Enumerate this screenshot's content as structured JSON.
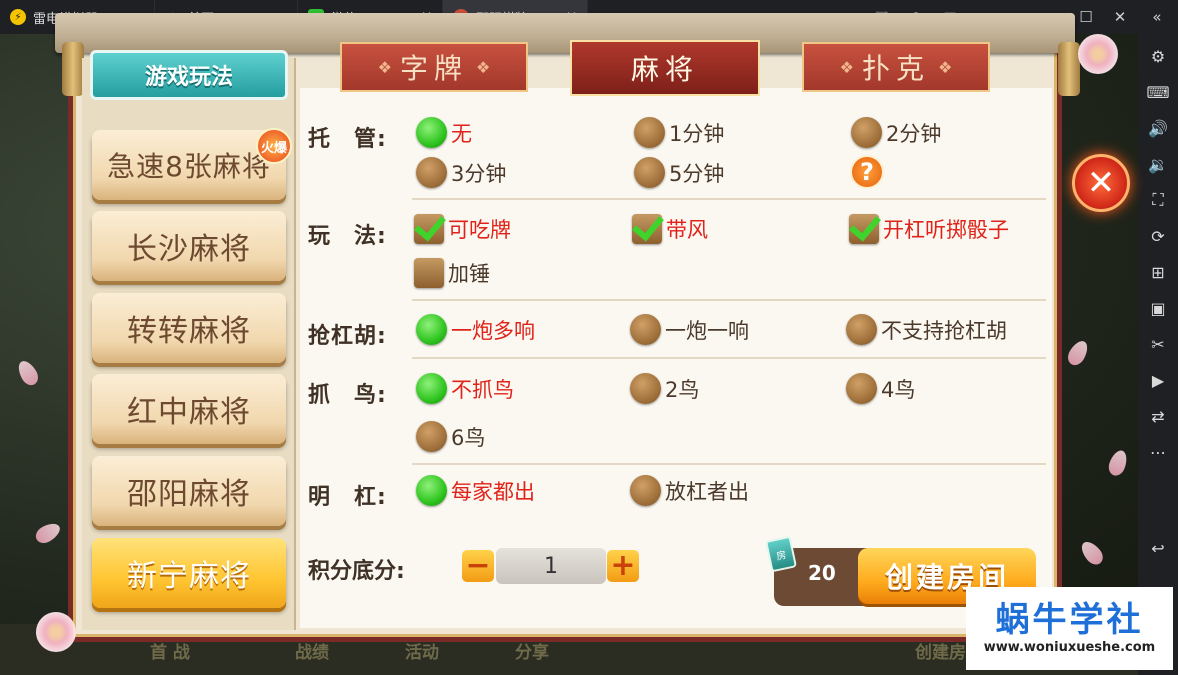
{
  "emulator": {
    "app_name": "雷电模拟器",
    "tabs": [
      {
        "label": "首页"
      },
      {
        "label": "微信"
      },
      {
        "label": "邵阳棋牌"
      }
    ],
    "close_glyph": "×",
    "window_buttons": [
      "gamepad-icon",
      "user-icon",
      "mail-icon",
      "menu-icon",
      "external-icon",
      "minimize-icon",
      "maximize-icon",
      "close-icon",
      "collapse-icon"
    ],
    "sidebar_icons": [
      "settings-icon",
      "keyboard-icon",
      "volume-up-icon",
      "volume-down-icon",
      "fullscreen-icon",
      "rotate-icon",
      "add-screen-icon",
      "apk-icon",
      "scissors-icon",
      "video-icon",
      "sync-icon",
      "more-icon",
      "back-icon"
    ]
  },
  "dialog": {
    "mode_header": "游戏玩法",
    "hot_badge": "火爆",
    "modes": [
      {
        "label": "急速8张麻将",
        "active": false
      },
      {
        "label": "长沙麻将",
        "active": false
      },
      {
        "label": "转转麻将",
        "active": false
      },
      {
        "label": "红中麻将",
        "active": false
      },
      {
        "label": "邵阳麻将",
        "active": false
      },
      {
        "label": "新宁麻将",
        "active": true
      }
    ],
    "categories": [
      {
        "label": "字牌",
        "active": false
      },
      {
        "label": "麻将",
        "active": true
      },
      {
        "label": "扑克",
        "active": false
      }
    ],
    "rules": {
      "trustee": {
        "label": "托　管:",
        "options": [
          {
            "label": "无",
            "selected": true
          },
          {
            "label": "1分钟",
            "selected": false
          },
          {
            "label": "2分钟",
            "selected": false
          },
          {
            "label": "3分钟",
            "selected": false
          },
          {
            "label": "5分钟",
            "selected": false
          }
        ],
        "help": "?"
      },
      "play": {
        "label": "玩　法:",
        "options": [
          {
            "label": "可吃牌",
            "checked": true
          },
          {
            "label": "带风",
            "checked": true
          },
          {
            "label": "开杠听掷骰子",
            "checked": true
          },
          {
            "label": "加锤",
            "checked": false
          }
        ]
      },
      "rob_kong": {
        "label": "抢杠胡:",
        "options": [
          {
            "label": "一炮多响",
            "selected": true
          },
          {
            "label": "一炮一响",
            "selected": false
          },
          {
            "label": "不支持抢杠胡",
            "selected": false
          }
        ]
      },
      "birds": {
        "label": "抓　鸟:",
        "options": [
          {
            "label": "不抓鸟",
            "selected": true
          },
          {
            "label": "2鸟",
            "selected": false
          },
          {
            "label": "4鸟",
            "selected": false
          },
          {
            "label": "6鸟",
            "selected": false
          }
        ]
      },
      "open_kong": {
        "label": "明　杠:",
        "options": [
          {
            "label": "每家都出",
            "selected": true
          },
          {
            "label": "放杠者出",
            "selected": false
          }
        ]
      }
    },
    "score": {
      "label": "积分底分:",
      "value": "1",
      "minus": "−",
      "plus": "+"
    },
    "room_cards": {
      "card_label": "房",
      "count": "20"
    },
    "create_button": "创建房间",
    "close_glyph": "✕"
  },
  "background_menu": [
    "首 战",
    "战绩",
    "活动",
    "分享",
    "创建房"
  ],
  "watermark": {
    "title": "蜗牛学社",
    "url": "www.woniuxueshe.com"
  }
}
